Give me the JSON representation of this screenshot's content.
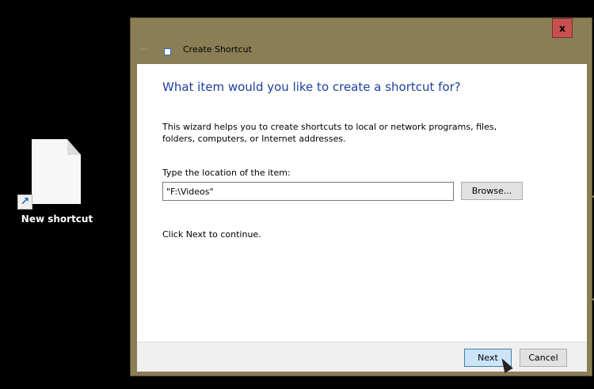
{
  "desktop": {
    "icon_label": "New shortcut"
  },
  "window": {
    "title": "Create Shortcut",
    "close": "x",
    "frame_color": "#8b7e55"
  },
  "wizard": {
    "heading": "What item would you like to create a shortcut for?",
    "description": "This wizard helps you to create shortcuts to local or network programs, files, folders, computers, or Internet addresses.",
    "location_label": "Type the location of the item:",
    "location_value": "\"F:\\Videos\"",
    "browse_label": "Browse...",
    "continue_text": "Click Next to continue."
  },
  "footer": {
    "next_label": "Next",
    "cancel_label": "Cancel"
  }
}
